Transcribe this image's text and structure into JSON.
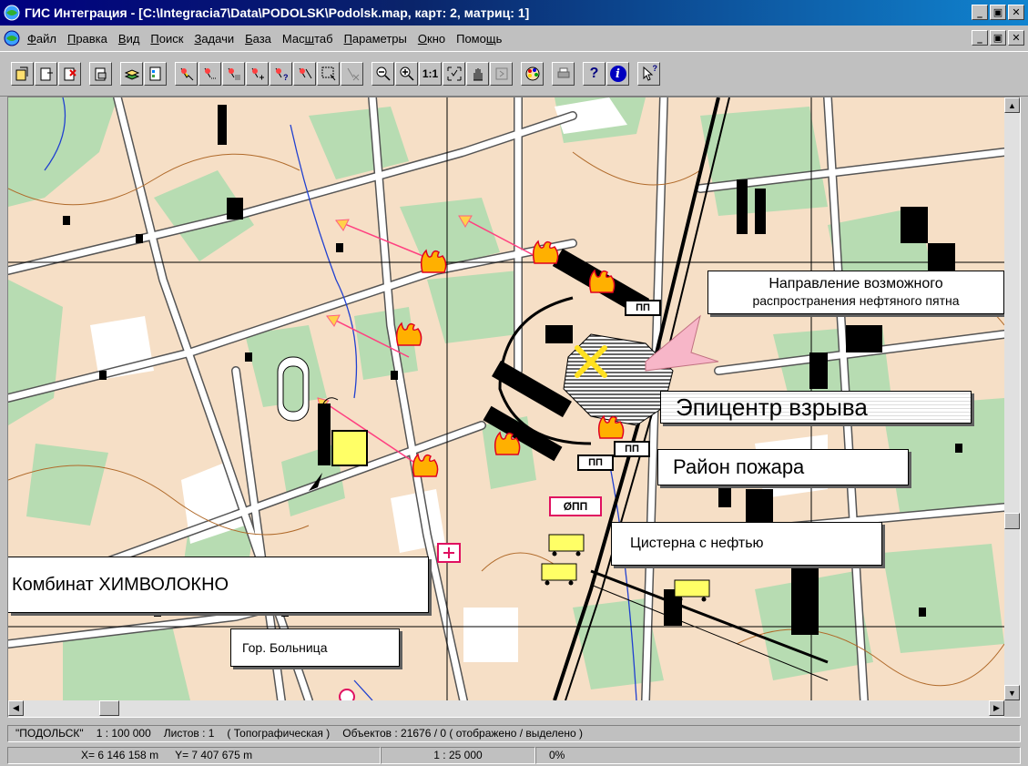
{
  "window": {
    "title": "ГИС Интеграция - [C:\\Integracia7\\Data\\PODOLSK\\Podolsk.map, карт: 2, матриц: 1]"
  },
  "menu": [
    {
      "u": "Ф",
      "rest": "айл"
    },
    {
      "u": "П",
      "rest": "равка"
    },
    {
      "u": "В",
      "rest": "ид"
    },
    {
      "u": "П",
      "rest": "оиск"
    },
    {
      "u": "З",
      "rest": "адачи"
    },
    {
      "u": "Б",
      "rest": "аза"
    },
    {
      "pre": "Мас",
      "u": "ш",
      "rest": "таб"
    },
    {
      "u": "П",
      "rest": "араметры"
    },
    {
      "u": "О",
      "rest": "кно"
    },
    {
      "pre": "Помо",
      "u": "щ",
      "rest": "ь"
    }
  ],
  "toolbar": {
    "scale_1_1_label": "1:1",
    "help_label": "?",
    "info_label": "i",
    "context_help_label": "?"
  },
  "map": {
    "labels": {
      "spread_line1": "Направление возможного",
      "spread_line2": "распространения нефтяного пятна",
      "epicenter": "Эпицентр взрыва",
      "fire_area": "Район пожара",
      "tank": "Цистерна с нефтью",
      "plant": "Комбинат ХИМВОЛОКНО",
      "hospital": "Гор. Больница"
    },
    "marker_codes": {
      "pp": "ПП",
      "gpp": "ØПП"
    }
  },
  "status": {
    "map_name": "\"ПОДОЛЬСК\"",
    "scale": "1 : 100 000",
    "sheets": "Листов : 1",
    "map_type": "( Топографическая )",
    "objects": "Объектов : 21676 / 0 ( отображено / выделено )",
    "x": "X=  6 146 158 m",
    "y": "Y=  7 407 675 m",
    "view_scale": "1 : 25 000",
    "progress": "0%"
  },
  "colors": {
    "title_bar": "#000080",
    "map_background": "#f6dfc6",
    "vegetation": "#b7dcb2",
    "fire": "#ffb000",
    "tank": "#ffff66",
    "accent": "#e01060"
  }
}
